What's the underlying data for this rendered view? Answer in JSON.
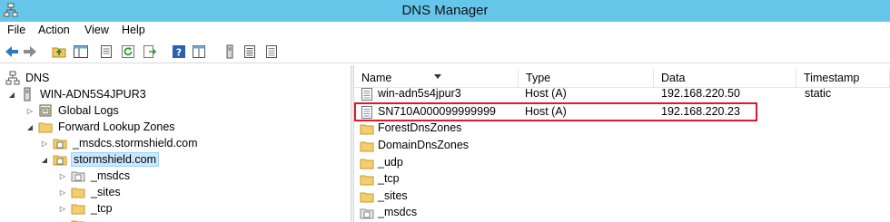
{
  "window": {
    "title": "DNS Manager"
  },
  "menu": {
    "file": "File",
    "action": "Action",
    "view": "View",
    "help": "Help"
  },
  "toolbar": {
    "buttons": [
      "back-icon",
      "forward-icon",
      "up-folder-icon",
      "show-hide-tree-icon",
      "properties-icon",
      "refresh-icon",
      "export-list-icon",
      "help-icon",
      "show-console-icon",
      "server-icon",
      "list-view-icon",
      "details-view-icon"
    ]
  },
  "tree": {
    "root": "DNS",
    "server": "WIN-ADN5S4JPUR3",
    "global_logs": "Global Logs",
    "forward_zones": "Forward Lookup Zones",
    "zone_msdcs": "_msdcs.stormshield.com",
    "zone_stormshield": "stormshield.com",
    "child_msdcs": "_msdcs",
    "child_sites": "_sites",
    "child_tcp": "_tcp"
  },
  "list": {
    "columns": {
      "name": "Name",
      "type": "Type",
      "data": "Data",
      "timestamp": "Timestamp"
    },
    "rows": [
      {
        "name": "win-adn5s4jpur3",
        "type": "Host (A)",
        "data": "192.168.220.50",
        "timestamp": "static",
        "icon": "host-record-icon"
      },
      {
        "name": "SN710A000099999999",
        "type": "Host (A)",
        "data": "192.168.220.23",
        "timestamp": "",
        "icon": "host-record-icon"
      },
      {
        "name": "ForestDnsZones",
        "type": "",
        "data": "",
        "timestamp": "",
        "icon": "folder-icon"
      },
      {
        "name": "DomainDnsZones",
        "type": "",
        "data": "",
        "timestamp": "",
        "icon": "folder-icon"
      },
      {
        "name": "_udp",
        "type": "",
        "data": "",
        "timestamp": "",
        "icon": "folder-icon"
      },
      {
        "name": "_tcp",
        "type": "",
        "data": "",
        "timestamp": "",
        "icon": "folder-icon"
      },
      {
        "name": "_sites",
        "type": "",
        "data": "",
        "timestamp": "",
        "icon": "folder-icon"
      },
      {
        "name": "_msdcs",
        "type": "",
        "data": "",
        "timestamp": "",
        "icon": "zone-icon"
      }
    ]
  },
  "colors": {
    "titlebar": "#65c6ea",
    "highlight": "#e0182a",
    "selection": "#cce8ff"
  }
}
